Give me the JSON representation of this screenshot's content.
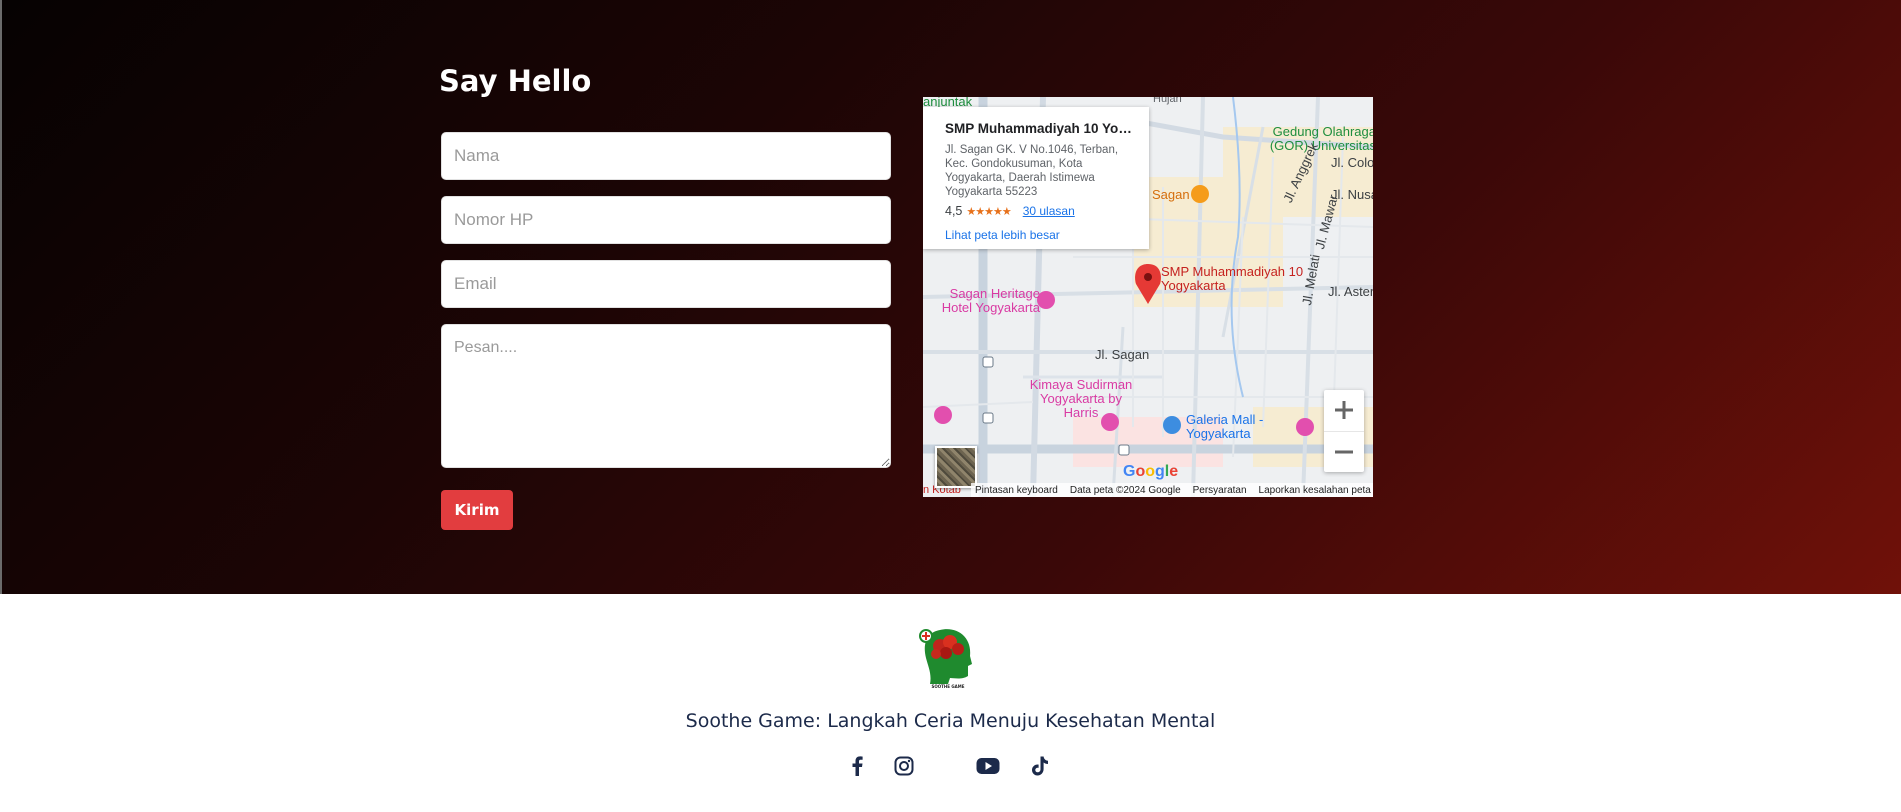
{
  "contact": {
    "heading": "Say Hello",
    "form": {
      "name_placeholder": "Nama",
      "phone_placeholder": "Nomor HP",
      "email_placeholder": "Email",
      "message_placeholder": "Pesan....",
      "submit_label": "Kirim"
    },
    "colors": {
      "submit": "#e23d3f",
      "background_dark": "#060202",
      "background_red": "#701109"
    }
  },
  "map": {
    "place_card": {
      "title": "SMP Muhammadiyah 10 Yogy...",
      "address": "Jl. Sagan GK. V No.1046, Terban, Kec. Gondokusuman, Kota Yogyakarta, Daerah Istimewa Yogyakarta 55223",
      "rating": "4,5",
      "stars": "★★★★★",
      "reviews": "30 ulasan",
      "bigger_map_link": "Lihat peta lebih besar"
    },
    "labels": {
      "school_marker": "SMP Muhammadiyah 10 Yogyakarta",
      "gor": "Gedung Olahraga (GOR) Universitas",
      "sagan_restaurant": "Sagan",
      "jl_anggrek": "Jl. Anggrek",
      "jl_mawar": "Jl. Mawar",
      "jl_nusa": "Jl. Nusa",
      "jl_colo": "Jl. Colo",
      "jl_melati": "Jl. Melati",
      "jl_aster": "Jl. Aster",
      "jl_sagan": "Jl. Sagan",
      "sagan_heritage": "Sagan Heritage Hotel Yogyakarta",
      "kimaya": "Kimaya Sudirman Yogyakarta by Harris",
      "galeria": "Galeria Mall - Yogyakarta",
      "manjuntak": "anjuntak",
      "hujan": "Hujan",
      "kotab": "n Kotab"
    },
    "footer": {
      "keyboard": "Pintasan keyboard",
      "data": "Data peta ©2024 Google",
      "terms": "Persyaratan",
      "report": "Laporkan kesalahan peta"
    },
    "google": "Google",
    "zoom_in_icon": "plus-icon",
    "zoom_out_icon": "minus-icon"
  },
  "footer": {
    "logo_text": "SOOTHE GAME",
    "tagline": "Soothe Game: Langkah Ceria Menuju Kesehatan Mental",
    "socials": [
      "facebook-icon",
      "instagram-icon",
      "youtube-icon",
      "tiktok-icon"
    ]
  }
}
